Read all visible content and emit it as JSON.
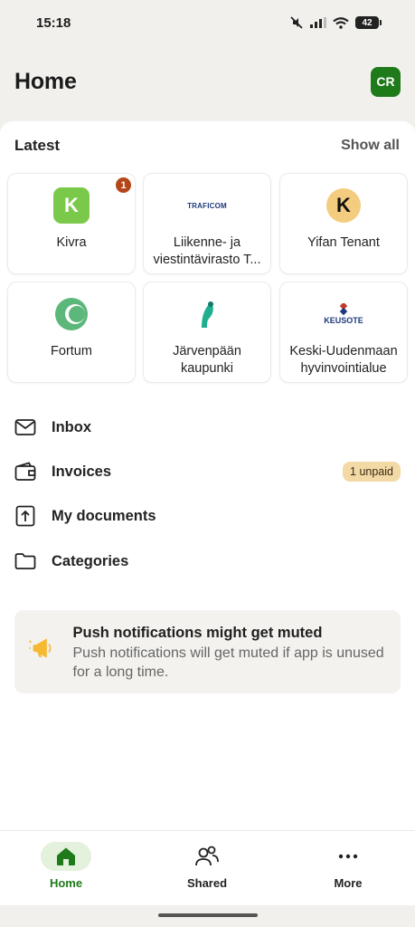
{
  "status_bar": {
    "time": "15:18",
    "battery": "42"
  },
  "header": {
    "title": "Home",
    "avatar_initials": "CR"
  },
  "latest": {
    "title": "Latest",
    "show_all": "Show all",
    "tiles": [
      {
        "label": "Kivra",
        "logo_text": "K",
        "badge": "1"
      },
      {
        "label": "Liikenne- ja viestintävirasto T...",
        "logo_text": "TRAFICOM"
      },
      {
        "label": "Yifan Tenant",
        "logo_text": "K"
      },
      {
        "label": "Fortum"
      },
      {
        "label": "Järvenpään kaupunki"
      },
      {
        "label": "Keski-Uudenmaan hyvinvointialue",
        "logo_text": "KEUSOTE"
      }
    ]
  },
  "nav": {
    "inbox": "Inbox",
    "invoices": "Invoices",
    "invoices_badge": "1 unpaid",
    "documents": "My documents",
    "categories": "Categories"
  },
  "notice": {
    "title": "Push notifications might get muted",
    "body": "Push notifications will get muted if app is unused for a long time."
  },
  "bottom_nav": {
    "home": "Home",
    "shared": "Shared",
    "more": "More"
  },
  "colors": {
    "accent": "#1f7a1a",
    "badge": "#b5461a",
    "unpaid_bg": "#f2d9a6"
  }
}
